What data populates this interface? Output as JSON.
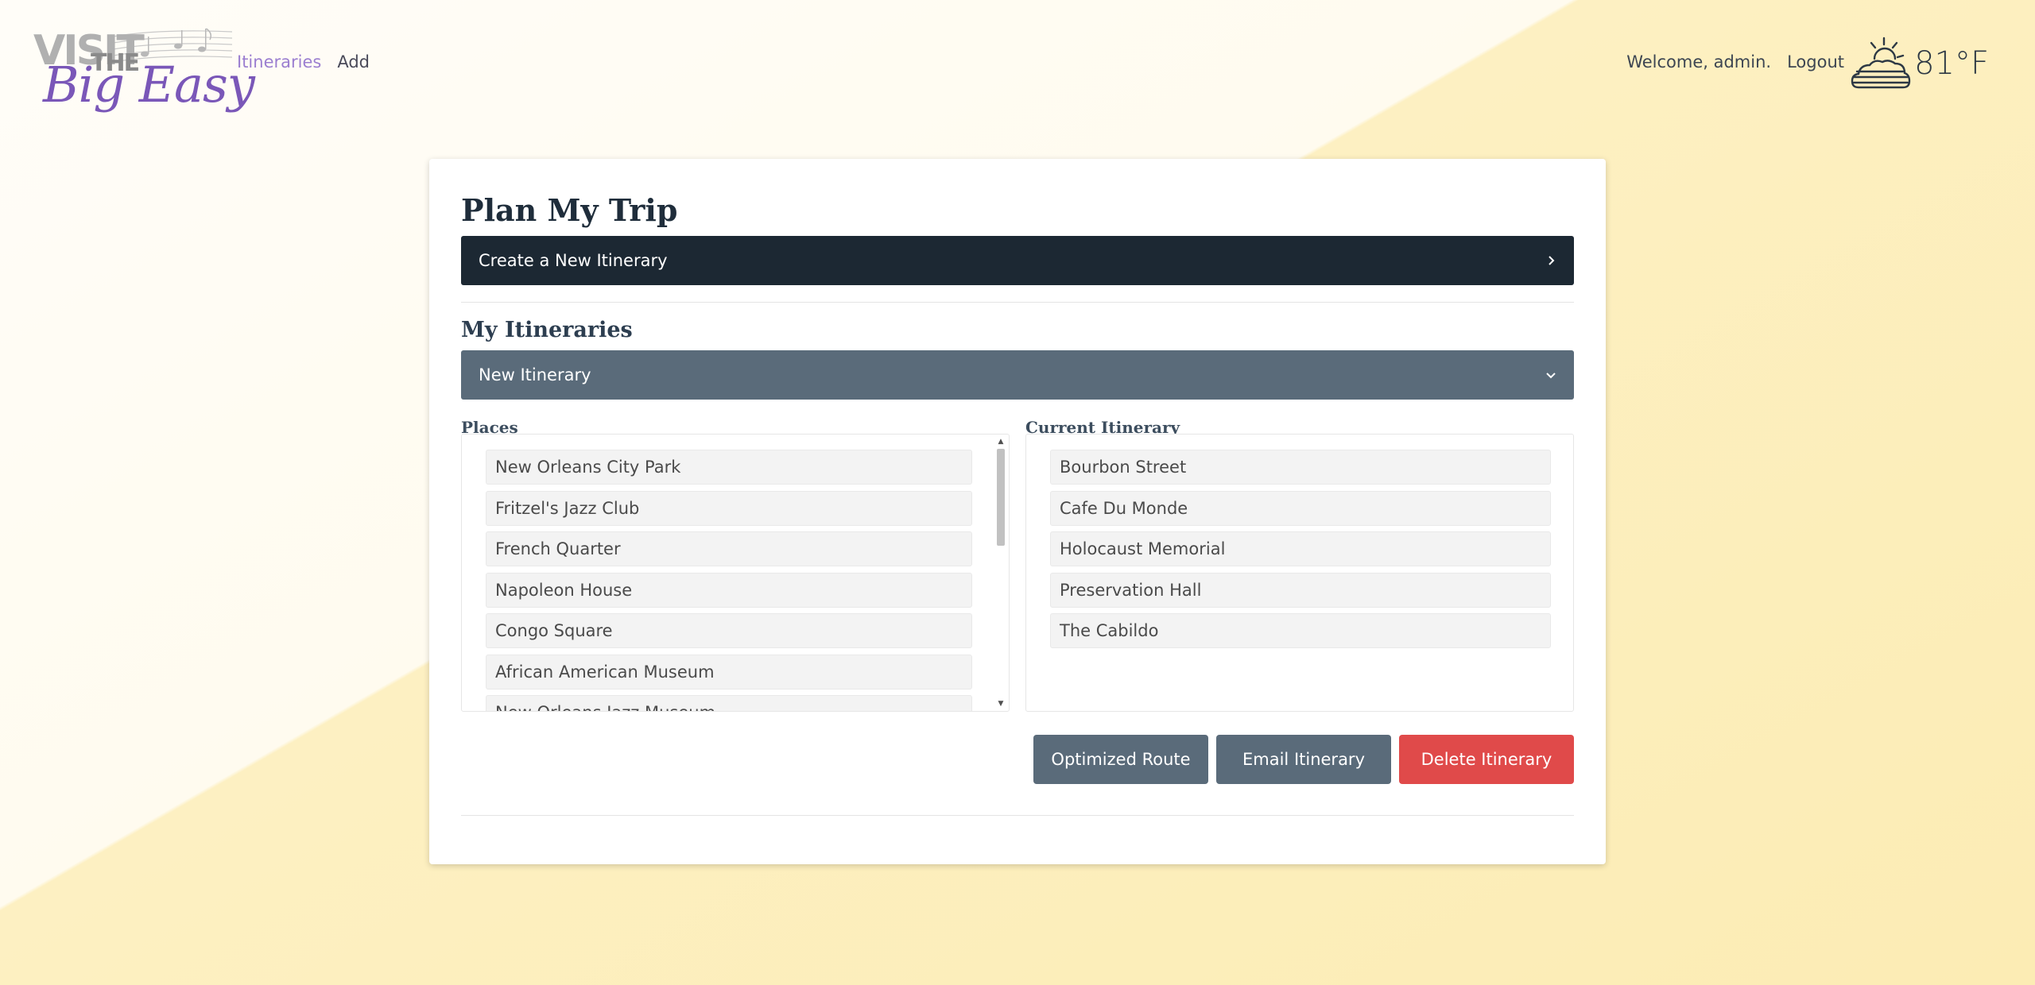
{
  "header": {
    "logo": {
      "visit": "VISIT",
      "the": "THE",
      "big_easy": "Big Easy"
    },
    "nav": [
      {
        "label": "Itineraries",
        "active": true
      },
      {
        "label": "Add",
        "active": false
      }
    ],
    "welcome": "Welcome, admin.",
    "logout": "Logout",
    "weather": {
      "icon": "partly-sunny-cloud-icon",
      "temperature": "81°F"
    }
  },
  "page": {
    "title": "Plan My Trip",
    "create_bar": {
      "label": "Create a New Itinerary",
      "icon": "chevron-right-icon"
    },
    "my_itineraries": {
      "heading": "My Itineraries",
      "selected": {
        "label": "New Itinerary",
        "icon": "chevron-down-icon"
      }
    },
    "places": {
      "heading": "Places",
      "items": [
        "New Orleans City Park",
        "Fritzel's Jazz Club",
        "French Quarter",
        "Napoleon House",
        "Congo Square",
        "African American Museum",
        "New Orleans Jazz Museum"
      ]
    },
    "current_itinerary": {
      "heading": "Current Itinerary",
      "items": [
        "Bourbon Street",
        "Cafe Du Monde",
        "Holocaust Memorial",
        "Preservation Hall",
        "The Cabildo"
      ]
    },
    "buttons": {
      "optimized_route": "Optimized Route",
      "email_itinerary": "Email Itinerary",
      "delete_itinerary": "Delete Itinerary"
    }
  },
  "colors": {
    "accent_purple": "#9b7ed0",
    "create_bar": "#1c2833",
    "itinerary_bar": "#5a6b7a",
    "delete_button": "#e04a4a"
  }
}
